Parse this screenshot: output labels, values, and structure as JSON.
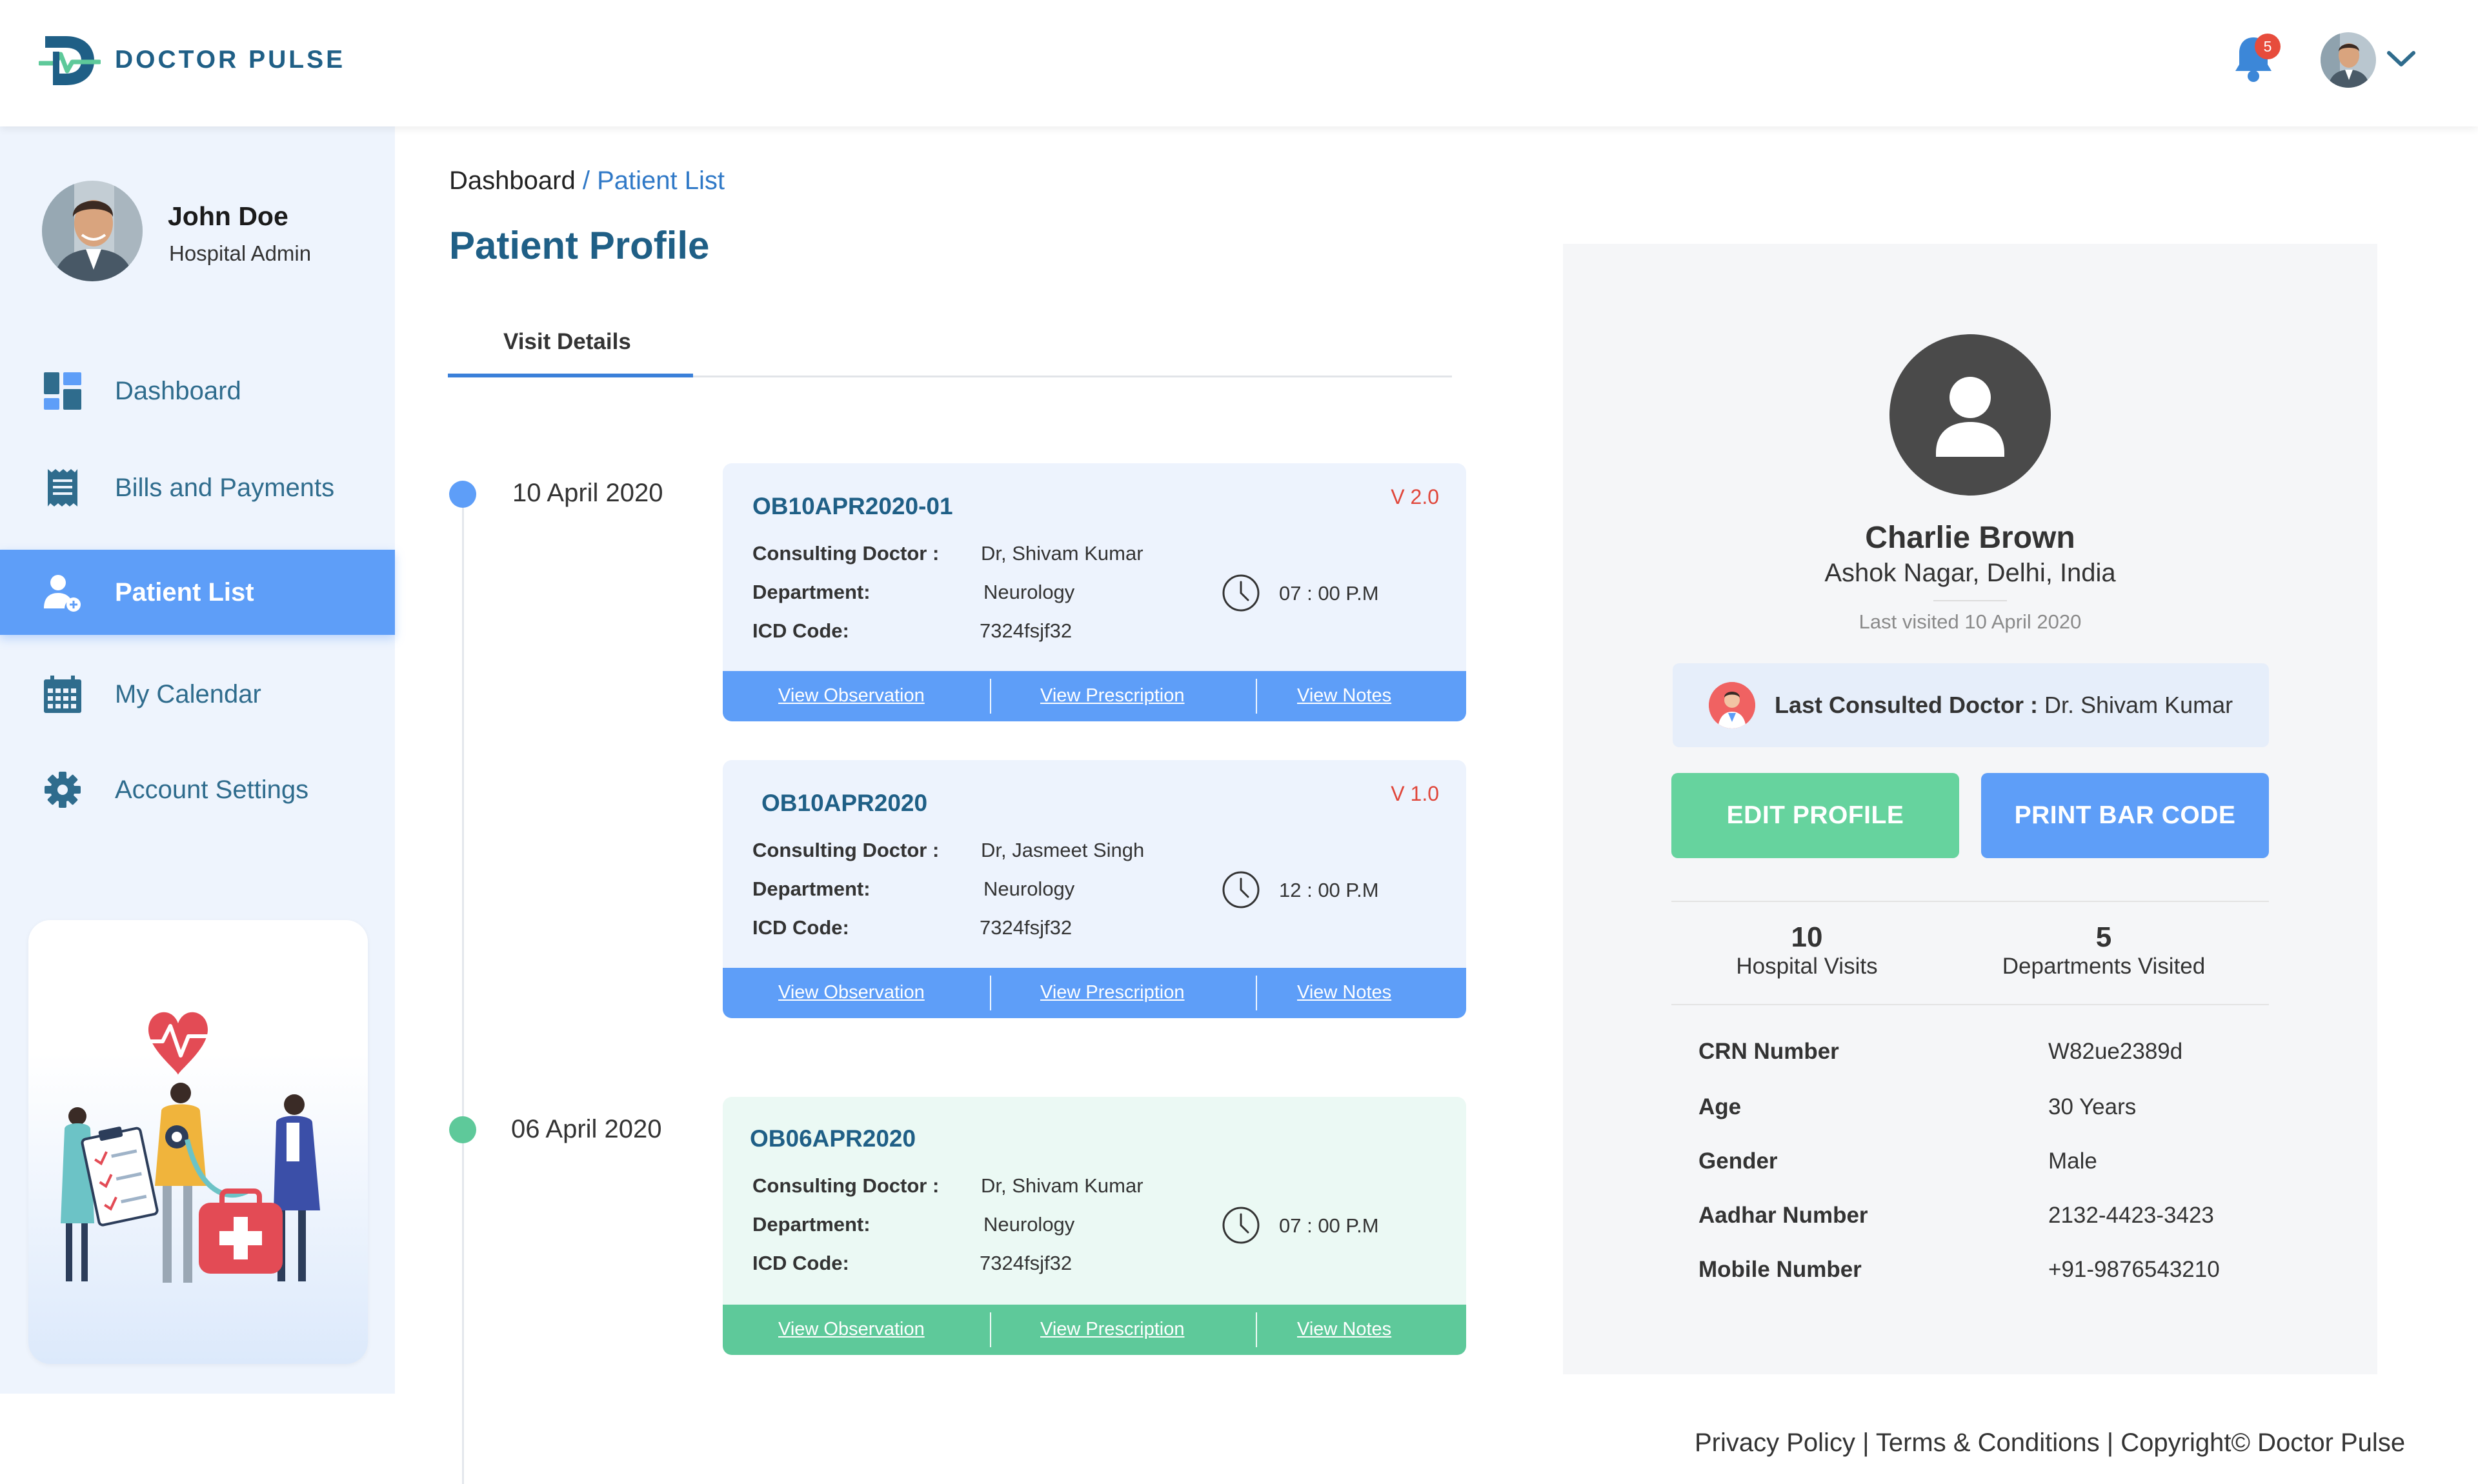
{
  "brand": {
    "name": "DOCTOR PULSE"
  },
  "header": {
    "notification_count": "5"
  },
  "user": {
    "name": "John Doe",
    "role": "Hospital Admin"
  },
  "sidebar": {
    "items": [
      {
        "label": "Dashboard",
        "icon": "dashboard-icon"
      },
      {
        "label": "Bills and Payments",
        "icon": "receipt-icon"
      },
      {
        "label": "Patient List",
        "icon": "patient-icon",
        "active": true
      },
      {
        "label": "My Calendar",
        "icon": "calendar-icon"
      },
      {
        "label": "Account Settings",
        "icon": "gear-icon"
      }
    ]
  },
  "breadcrumb": {
    "root": "Dashboard",
    "separator": "/",
    "current": "Patient List"
  },
  "page": {
    "title": "Patient Profile",
    "tab": "Visit Details"
  },
  "visits": [
    {
      "date": "10 April 2020",
      "cards": [
        {
          "id": "OB10APR2020-01",
          "version": "V 2.0",
          "doctor": "Dr, Shivam Kumar",
          "department": "Neurology",
          "icd": "7324fsjf32",
          "time": "07 : 00 P.M"
        },
        {
          "id": "OB10APR2020",
          "version": "V 1.0",
          "doctor": "Dr, Jasmeet Singh",
          "department": "Neurology",
          "icd": "7324fsjf32",
          "time": "12 : 00 P.M"
        }
      ]
    },
    {
      "date": "06 April 2020",
      "cards": [
        {
          "id": "OB06APR2020",
          "version": "",
          "doctor": "Dr, Shivam Kumar",
          "department": "Neurology",
          "icd": "7324fsjf32",
          "time": "07 : 00 P.M"
        }
      ]
    }
  ],
  "card_labels": {
    "doctor": "Consulting Doctor :",
    "department": "Department:",
    "icd": "ICD Code:",
    "view_observation": "View Observation ",
    "view_prescription": "View Prescription",
    "view_notes": "View Notes"
  },
  "patient": {
    "name": "Charlie Brown",
    "address": "Ashok Nagar, Delhi, India",
    "last_visited": "Last visited 10 April 2020",
    "last_doctor_label": "Last Consulted Doctor :",
    "last_doctor": " Dr. Shivam Kumar",
    "edit_button": "EDIT PROFILE",
    "print_button": "PRINT BAR CODE",
    "stats": [
      {
        "value": "10",
        "label": "Hospital Visits"
      },
      {
        "value": "5",
        "label": "Departments Visited"
      }
    ],
    "info": [
      {
        "label": "CRN Number",
        "value": "W82ue2389d"
      },
      {
        "label": "Age",
        "value": "30 Years"
      },
      {
        "label": "Gender",
        "value": "Male"
      },
      {
        "label": "Aadhar Number",
        "value": "2132-4423-3423"
      },
      {
        "label": "Mobile Number",
        "value": "+91-9876543210"
      }
    ]
  },
  "footer": {
    "privacy": "Privacy Policy",
    "terms": "Terms & Conditions",
    "copyright": "Copyright© Doctor Pulse",
    "separator": "|"
  },
  "colors": {
    "brand": "#1f5f86",
    "accent_blue": "#5e9ef8",
    "accent_green": "#5ec99a",
    "version_red": "#e0463a",
    "sidebar_bg": "#eef4fd"
  }
}
